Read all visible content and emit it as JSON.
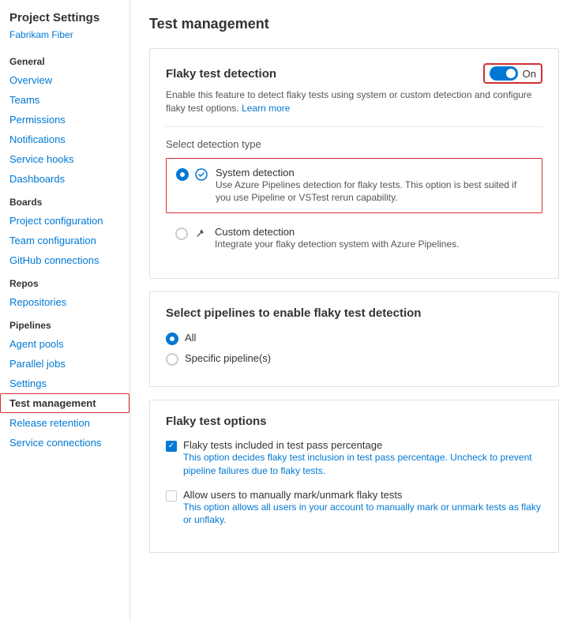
{
  "sidebar": {
    "title": "Project Settings",
    "subtitle": "Fabrikam Fiber",
    "sections": [
      {
        "label": "General",
        "items": [
          {
            "id": "overview",
            "label": "Overview",
            "active": false
          },
          {
            "id": "teams",
            "label": "Teams",
            "active": false
          },
          {
            "id": "permissions",
            "label": "Permissions",
            "active": false
          },
          {
            "id": "notifications",
            "label": "Notifications",
            "active": false
          },
          {
            "id": "service-hooks",
            "label": "Service hooks",
            "active": false
          },
          {
            "id": "dashboards",
            "label": "Dashboards",
            "active": false
          }
        ]
      },
      {
        "label": "Boards",
        "items": [
          {
            "id": "project-configuration",
            "label": "Project configuration",
            "active": false
          },
          {
            "id": "team-configuration",
            "label": "Team configuration",
            "active": false
          },
          {
            "id": "github-connections",
            "label": "GitHub connections",
            "active": false
          }
        ]
      },
      {
        "label": "Repos",
        "items": [
          {
            "id": "repositories",
            "label": "Repositories",
            "active": false
          }
        ]
      },
      {
        "label": "Pipelines",
        "items": [
          {
            "id": "agent-pools",
            "label": "Agent pools",
            "active": false
          },
          {
            "id": "parallel-jobs",
            "label": "Parallel jobs",
            "active": false
          },
          {
            "id": "settings",
            "label": "Settings",
            "active": false
          },
          {
            "id": "test-management",
            "label": "Test management",
            "active": true
          },
          {
            "id": "release-retention",
            "label": "Release retention",
            "active": false
          },
          {
            "id": "service-connections",
            "label": "Service connections",
            "active": false
          }
        ]
      }
    ]
  },
  "main": {
    "page_title": "Test management",
    "flaky_detection": {
      "title": "Flaky test detection",
      "toggle_label": "On",
      "toggle_on": true,
      "description": "Enable this feature to detect flaky tests using system or custom detection and configure flaky test options.",
      "learn_more": "Learn more",
      "detection_type_label": "Select detection type",
      "options": [
        {
          "id": "system",
          "title": "System detection",
          "description": "Use Azure Pipelines detection for flaky tests. This option is best suited if you use Pipeline or VSTest rerun capability.",
          "selected": true
        },
        {
          "id": "custom",
          "title": "Custom detection",
          "description": "Integrate your flaky detection system with Azure Pipelines.",
          "selected": false
        }
      ]
    },
    "pipelines_section": {
      "title": "Select pipelines to enable flaky test detection",
      "options": [
        {
          "id": "all",
          "label": "All",
          "selected": true
        },
        {
          "id": "specific",
          "label": "Specific pipeline(s)",
          "selected": false
        }
      ]
    },
    "flaky_options": {
      "title": "Flaky test options",
      "checkboxes": [
        {
          "id": "included",
          "title": "Flaky tests included in test pass percentage",
          "description": "This option decides flaky test inclusion in test pass percentage. Uncheck to prevent pipeline failures due to flaky tests.",
          "checked": true
        },
        {
          "id": "manual-mark",
          "title": "Allow users to manually mark/unmark flaky tests",
          "description": "This option allows all users in your account to manually mark or unmark tests as flaky or unflaky.",
          "checked": false
        }
      ]
    }
  }
}
